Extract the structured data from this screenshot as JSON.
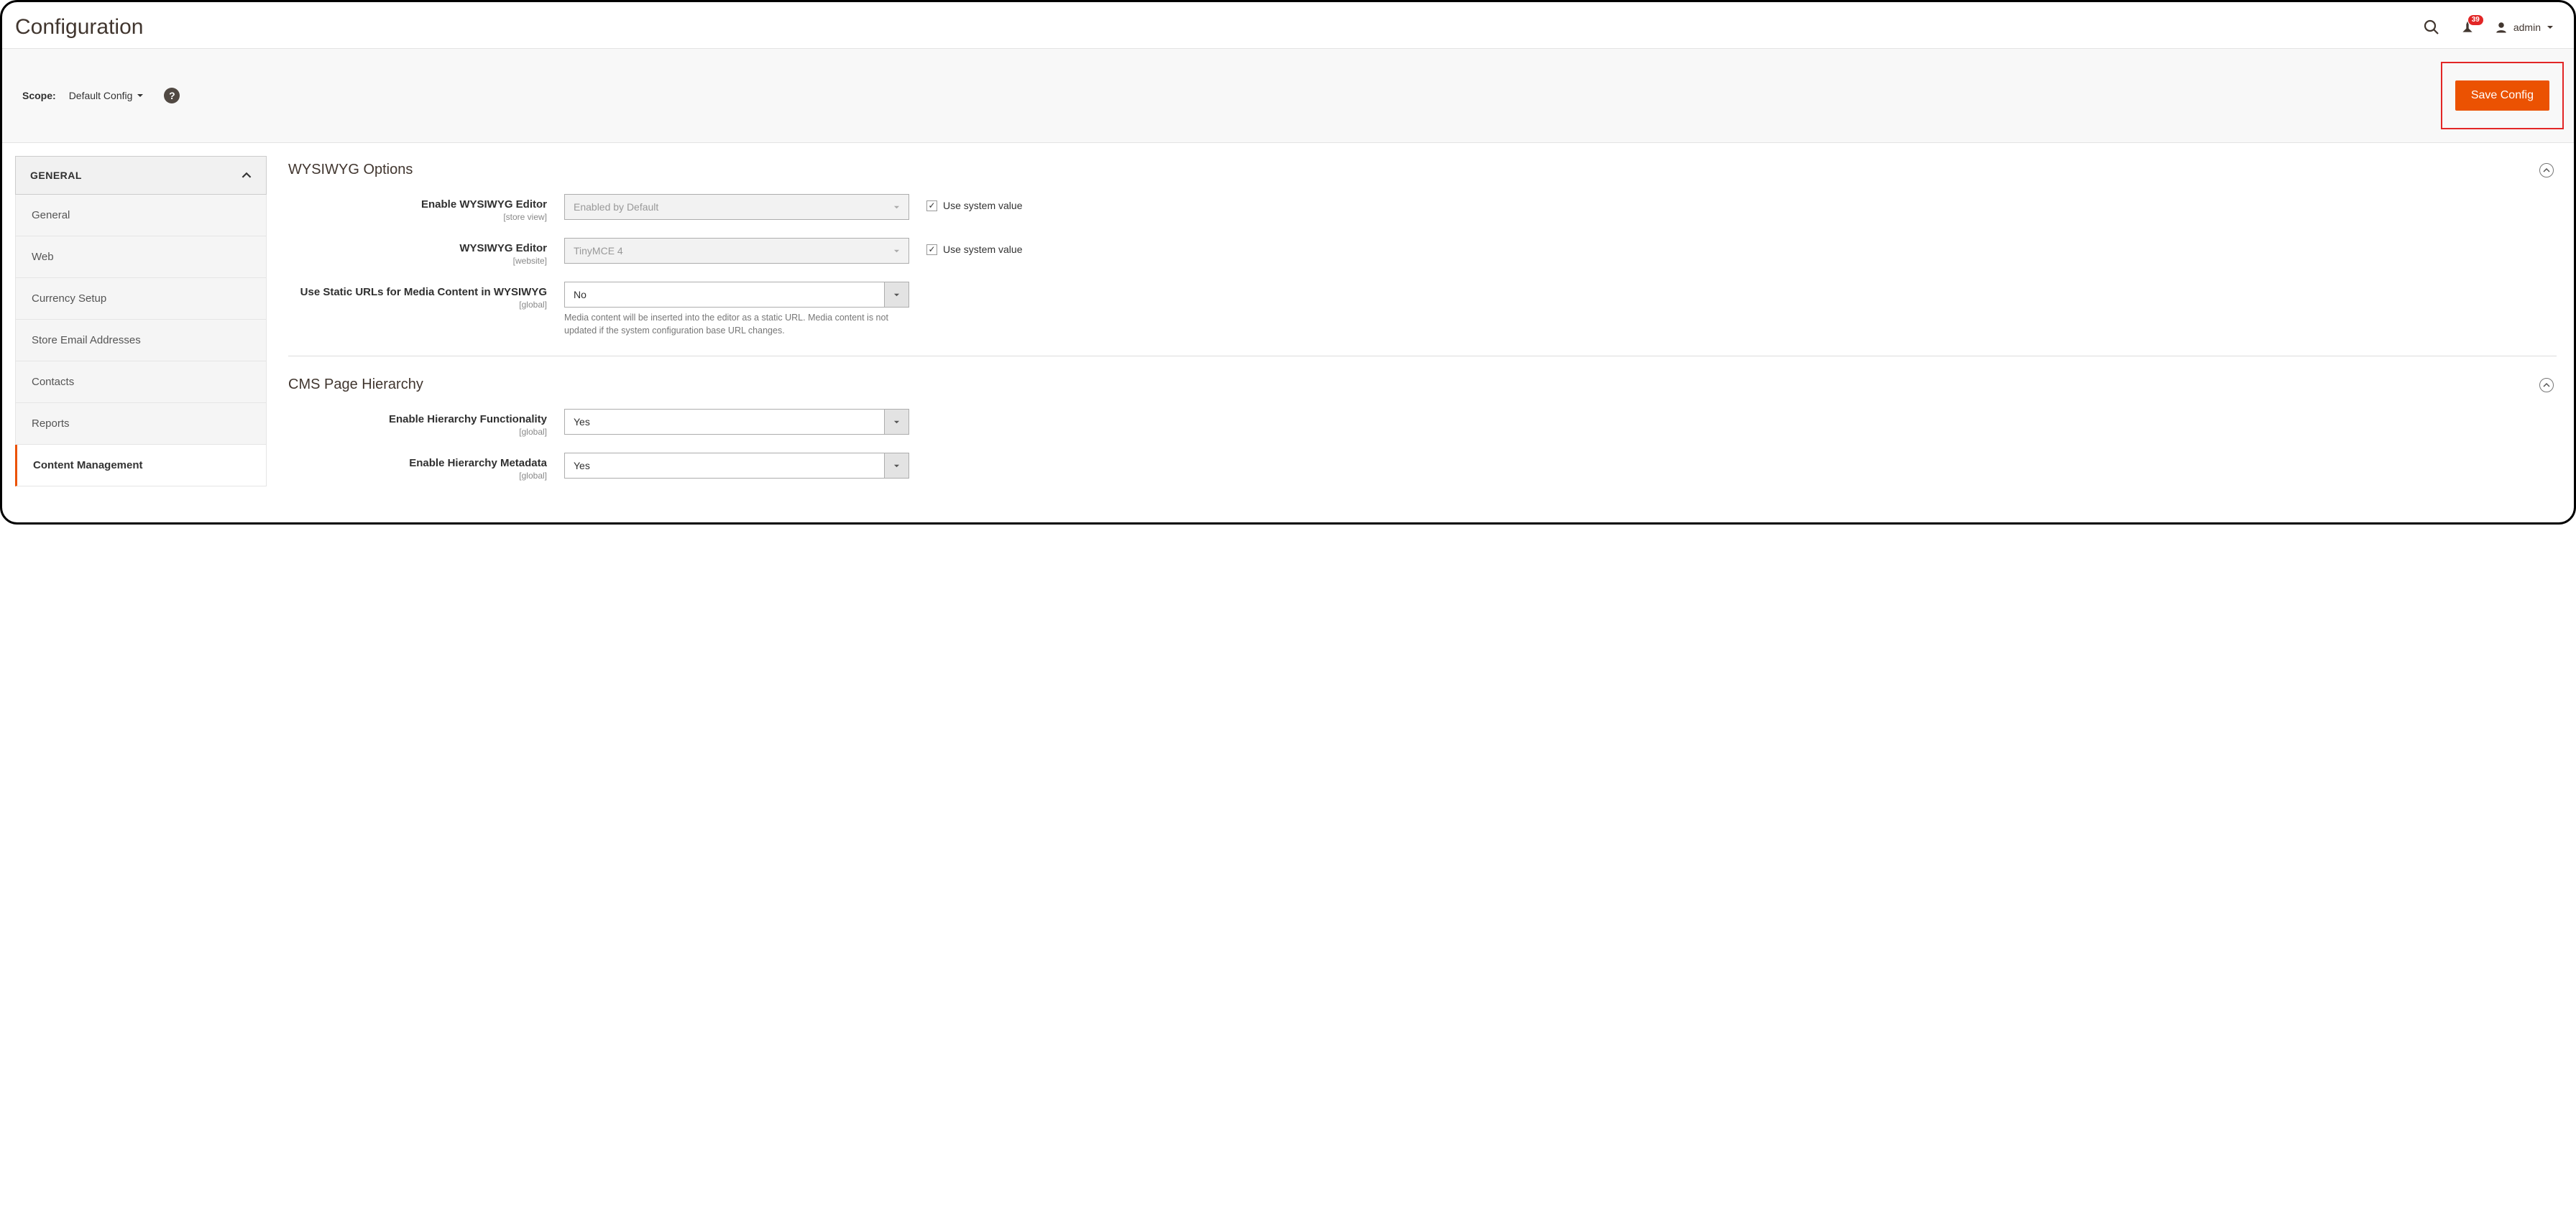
{
  "header": {
    "title": "Configuration",
    "notification_count": "39",
    "username": "admin"
  },
  "actionbar": {
    "scope_label": "Scope:",
    "scope_value": "Default Config",
    "save_label": "Save Config"
  },
  "sidebar": {
    "group": "GENERAL",
    "items": [
      {
        "label": "General"
      },
      {
        "label": "Web"
      },
      {
        "label": "Currency Setup"
      },
      {
        "label": "Store Email Addresses"
      },
      {
        "label": "Contacts"
      },
      {
        "label": "Reports"
      },
      {
        "label": "Content Management"
      }
    ]
  },
  "section1": {
    "title": "WYSIWYG Options",
    "row1": {
      "label": "Enable WYSIWYG Editor",
      "scope": "[store view]",
      "value": "Enabled by Default",
      "use_system": "Use system value"
    },
    "row2": {
      "label": "WYSIWYG Editor",
      "scope": "[website]",
      "value": "TinyMCE 4",
      "use_system": "Use system value"
    },
    "row3": {
      "label": "Use Static URLs for Media Content in WYSIWYG",
      "scope": "[global]",
      "value": "No",
      "note": "Media content will be inserted into the editor as a static URL. Media content is not updated if the system configuration base URL changes."
    }
  },
  "section2": {
    "title": "CMS Page Hierarchy",
    "row1": {
      "label": "Enable Hierarchy Functionality",
      "scope": "[global]",
      "value": "Yes"
    },
    "row2": {
      "label": "Enable Hierarchy Metadata",
      "scope": "[global]",
      "value": "Yes"
    }
  }
}
